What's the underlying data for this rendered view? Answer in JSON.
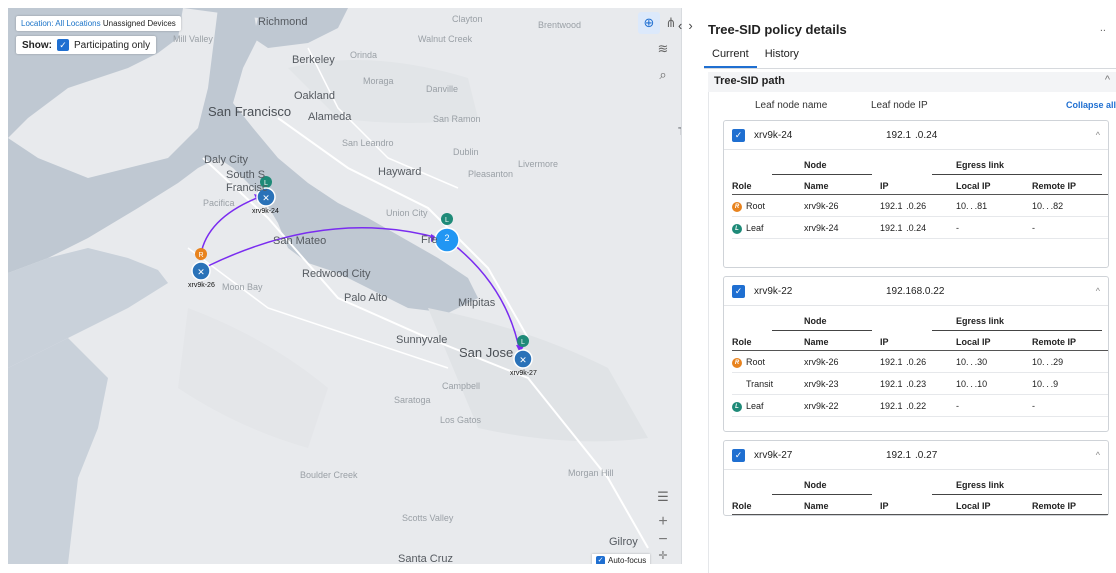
{
  "map": {
    "location_label": "Location:",
    "location_value": "All Locations",
    "location_extra": "Unassigned Devices",
    "show_label": "Show:",
    "participating_label": "Participating only",
    "auto_focus_label": "Auto-focus",
    "places": {
      "san_francisco": "San Francisco",
      "oakland": "Oakland",
      "alameda": "Alameda",
      "berkeley": "Berkeley",
      "richmond": "Richmond",
      "daly_city": "Daly City",
      "south_sf": "South S",
      "francisco": "Francisc",
      "hayward": "Hayward",
      "san_mateo": "San Mateo",
      "redwood_city": "Redwood City",
      "palo_alto": "Palo Alto",
      "milpitas": "Milpitas",
      "sunnyvale": "Sunnyvale",
      "san_jose": "San Jose",
      "campbell": "Campbell",
      "saratoga": "Saratoga",
      "los_gatos": "Los Gatos",
      "gilroy": "Gilroy",
      "santa_cruz": "Santa Cruz",
      "scotts_valley": "Scotts Valley",
      "morgan_hill": "Morgan Hill",
      "boulder_creek": "Boulder Creek",
      "pleasanton": "Pleasanton",
      "livermore": "Livermore",
      "dublin": "Dublin",
      "san_ramon": "San Ramon",
      "danville": "Danville",
      "moraga": "Moraga",
      "orinda": "Orinda",
      "walnut_creek": "Walnut Creek",
      "clayton": "Clayton",
      "brentwood": "Brentwood",
      "mill_valley": "Mill Valley",
      "san_leandro": "San Leandro",
      "union_city": "Union City",
      "pacifica": "Pacifica",
      "moon_bay": "Moon Bay",
      "fre": "Fre",
      "tr": "Tr"
    },
    "nodes": [
      {
        "id": "xrv9k-24",
        "label": "xrv9k-24",
        "role": "L"
      },
      {
        "id": "xrv9k-26",
        "label": "xrv9k-26",
        "role": "R"
      },
      {
        "id": "xrv9k-27",
        "label": "xrv9k-27",
        "role": "L"
      }
    ],
    "cluster_count": "2",
    "cluster_role": "L"
  },
  "panel": {
    "title": "Tree-SID policy details",
    "menu": "..",
    "tabs": [
      "Current",
      "History"
    ],
    "active_tab": "Current",
    "section_title": "Tree-SID path",
    "col_leaf_name": "Leaf node name",
    "col_leaf_ip": "Leaf node IP",
    "collapse_all": "Collapse all",
    "table_group_node": "Node",
    "table_group_egress": "Egress link",
    "table_headers": [
      "Role",
      "Name",
      "IP",
      "Local IP",
      "Remote IP"
    ],
    "leaves": [
      {
        "name": "xrv9k-24",
        "ip": "192.1  .0.24",
        "rows": [
          {
            "role": "Root",
            "badge": "R",
            "name": "xrv9k-26",
            "ip": "192.1  .0.26",
            "local": "10. . .81",
            "remote": "10. . .82"
          },
          {
            "role": "Leaf",
            "badge": "L",
            "name": "xrv9k-24",
            "ip": "192.1  .0.24",
            "local": "-",
            "remote": "-"
          }
        ]
      },
      {
        "name": "xrv9k-22",
        "ip": "192.168.0.22",
        "rows": [
          {
            "role": "Root",
            "badge": "R",
            "name": "xrv9k-26",
            "ip": "192.1  .0.26",
            "local": "10. . .30",
            "remote": "10. . .29"
          },
          {
            "role": "Transit",
            "badge": "",
            "name": "xrv9k-23",
            "ip": "192.1  .0.23",
            "local": "10. . .10",
            "remote": "10. . .9"
          },
          {
            "role": "Leaf",
            "badge": "L",
            "name": "xrv9k-22",
            "ip": "192.1  .0.22",
            "local": "-",
            "remote": "-"
          }
        ]
      },
      {
        "name": "xrv9k-27",
        "ip": "192.1  .0.27",
        "rows": []
      }
    ]
  },
  "colors": {
    "accent": "#1f6fd1",
    "root_badge": "#e8831e",
    "leaf_badge": "#1e8a78",
    "device_node": "#2a72b8",
    "path_line": "#7a2cf0"
  }
}
